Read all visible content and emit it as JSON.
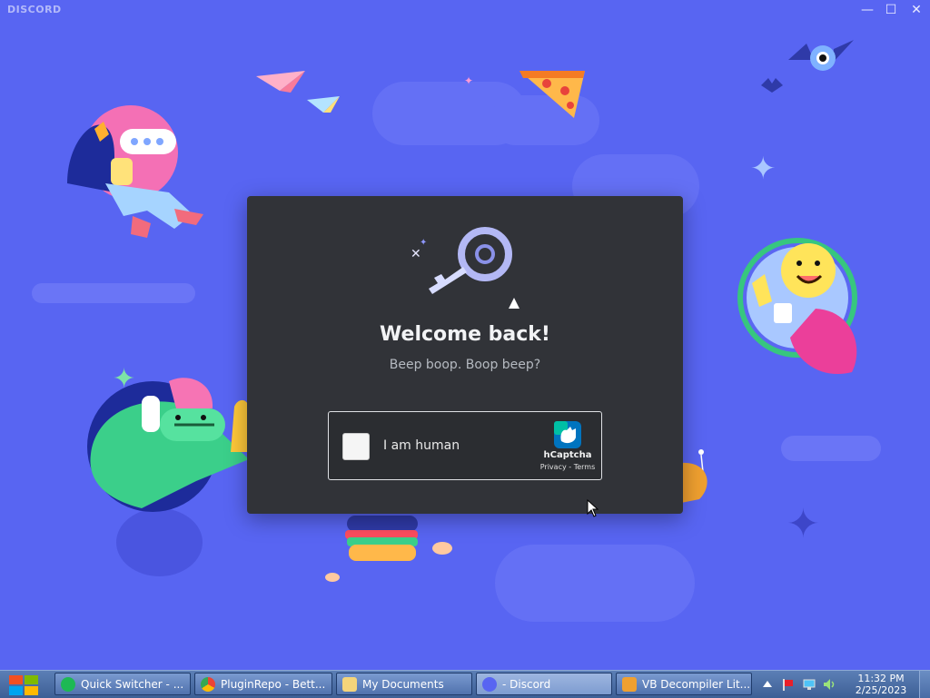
{
  "window": {
    "brand": "DISCORD",
    "controls": {
      "minimize": "—",
      "maximize": "☐",
      "close": "✕"
    }
  },
  "modal": {
    "heading": "Welcome back!",
    "subheading": "Beep boop. Boop beep?",
    "captcha": {
      "label": "I am human",
      "brand": "hCaptcha",
      "privacy": "Privacy",
      "separator": " - ",
      "terms": "Terms"
    }
  },
  "taskbar": {
    "items": [
      {
        "label": "Quick Switcher - ...",
        "icon": "spotify-icon",
        "color": "#1db954"
      },
      {
        "label": "PluginRepo - Bett...",
        "icon": "chrome-icon",
        "color": "#ea4335"
      },
      {
        "label": "My Documents",
        "icon": "folder-icon",
        "color": "#f4d47a"
      },
      {
        "label": "- Discord",
        "icon": "discord-icon",
        "color": "#5865f2"
      },
      {
        "label": "VB Decompiler Lit...",
        "icon": "vb-decompiler-icon",
        "color": "#f0a030"
      }
    ],
    "clock": {
      "time": "11:32 PM",
      "date": "2/25/2023"
    }
  },
  "colors": {
    "background": "#5865f2",
    "modal": "#313338",
    "taskbar": "#4a6ca5"
  }
}
